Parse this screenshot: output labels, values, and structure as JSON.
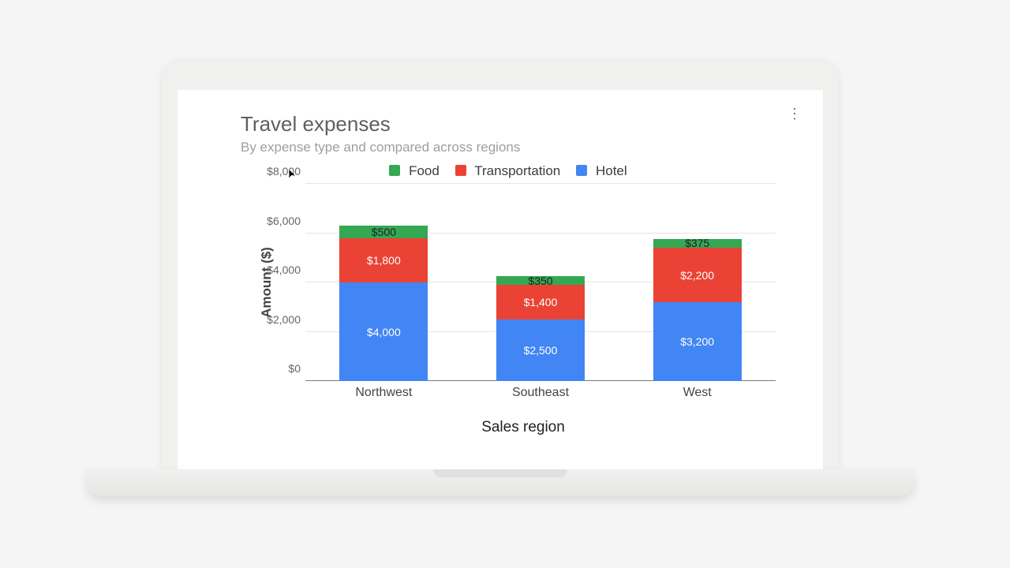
{
  "title": "Travel expenses",
  "subtitle": "By expense type and compared across regions",
  "menu_icon": "⋮",
  "legend": {
    "food": {
      "label": "Food",
      "color": "#34a853"
    },
    "trans": {
      "label": "Transportation",
      "color": "#ea4335"
    },
    "hotel": {
      "label": "Hotel",
      "color": "#4285f4"
    }
  },
  "yaxis": {
    "label": "Amount ($)",
    "ticks": [
      "$0",
      "$2,000",
      "$4,000",
      "$6,000",
      "$8,000"
    ]
  },
  "xaxis": {
    "label": "Sales region",
    "categories": [
      "Northwest",
      "Southeast",
      "West"
    ]
  },
  "data_labels": {
    "nw": {
      "food": "$500",
      "trans": "$1,800",
      "hotel": "$4,000"
    },
    "se": {
      "food": "$350",
      "trans": "$1,400",
      "hotel": "$2,500"
    },
    "w": {
      "food": "$375",
      "trans": "$2,200",
      "hotel": "$3,200"
    }
  },
  "chart_data": {
    "type": "bar",
    "stacked": true,
    "title": "Travel expenses",
    "subtitle": "By expense type and compared across regions",
    "xlabel": "Sales region",
    "ylabel": "Amount ($)",
    "ylim": [
      0,
      8000
    ],
    "yticks": [
      0,
      2000,
      4000,
      6000,
      8000
    ],
    "categories": [
      "Northwest",
      "Southeast",
      "West"
    ],
    "series": [
      {
        "name": "Hotel",
        "color": "#4285f4",
        "values": [
          4000,
          2500,
          3200
        ]
      },
      {
        "name": "Transportation",
        "color": "#ea4335",
        "values": [
          1800,
          1400,
          2200
        ]
      },
      {
        "name": "Food",
        "color": "#34a853",
        "values": [
          500,
          350,
          375
        ]
      }
    ]
  }
}
